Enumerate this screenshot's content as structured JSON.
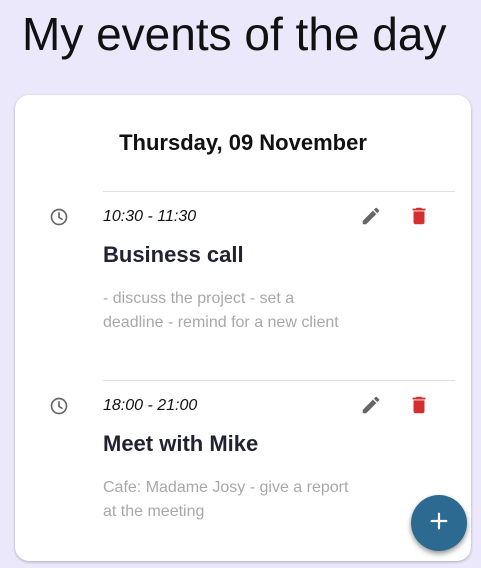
{
  "page": {
    "title": "My events of the day"
  },
  "card": {
    "date": "Thursday, 09 November"
  },
  "events": [
    {
      "time": "10:30 - 11:30",
      "title": "Business call",
      "description": "- discuss the project - set a deadline - remind for a new client"
    },
    {
      "time": "18:00 - 21:00",
      "title": "Meet with Mike",
      "description": "Cafe: Madame Josy - give a report at the meeting"
    }
  ],
  "icons": {
    "clock": "clock-icon",
    "edit": "pencil-icon",
    "delete": "trash-icon",
    "add": "plus-icon"
  },
  "colors": {
    "background": "#ebe8fc",
    "card": "#ffffff",
    "delete": "#d32f2f",
    "edit": "#666666",
    "fab": "#2c6a92",
    "description": "#a8a8a8"
  }
}
